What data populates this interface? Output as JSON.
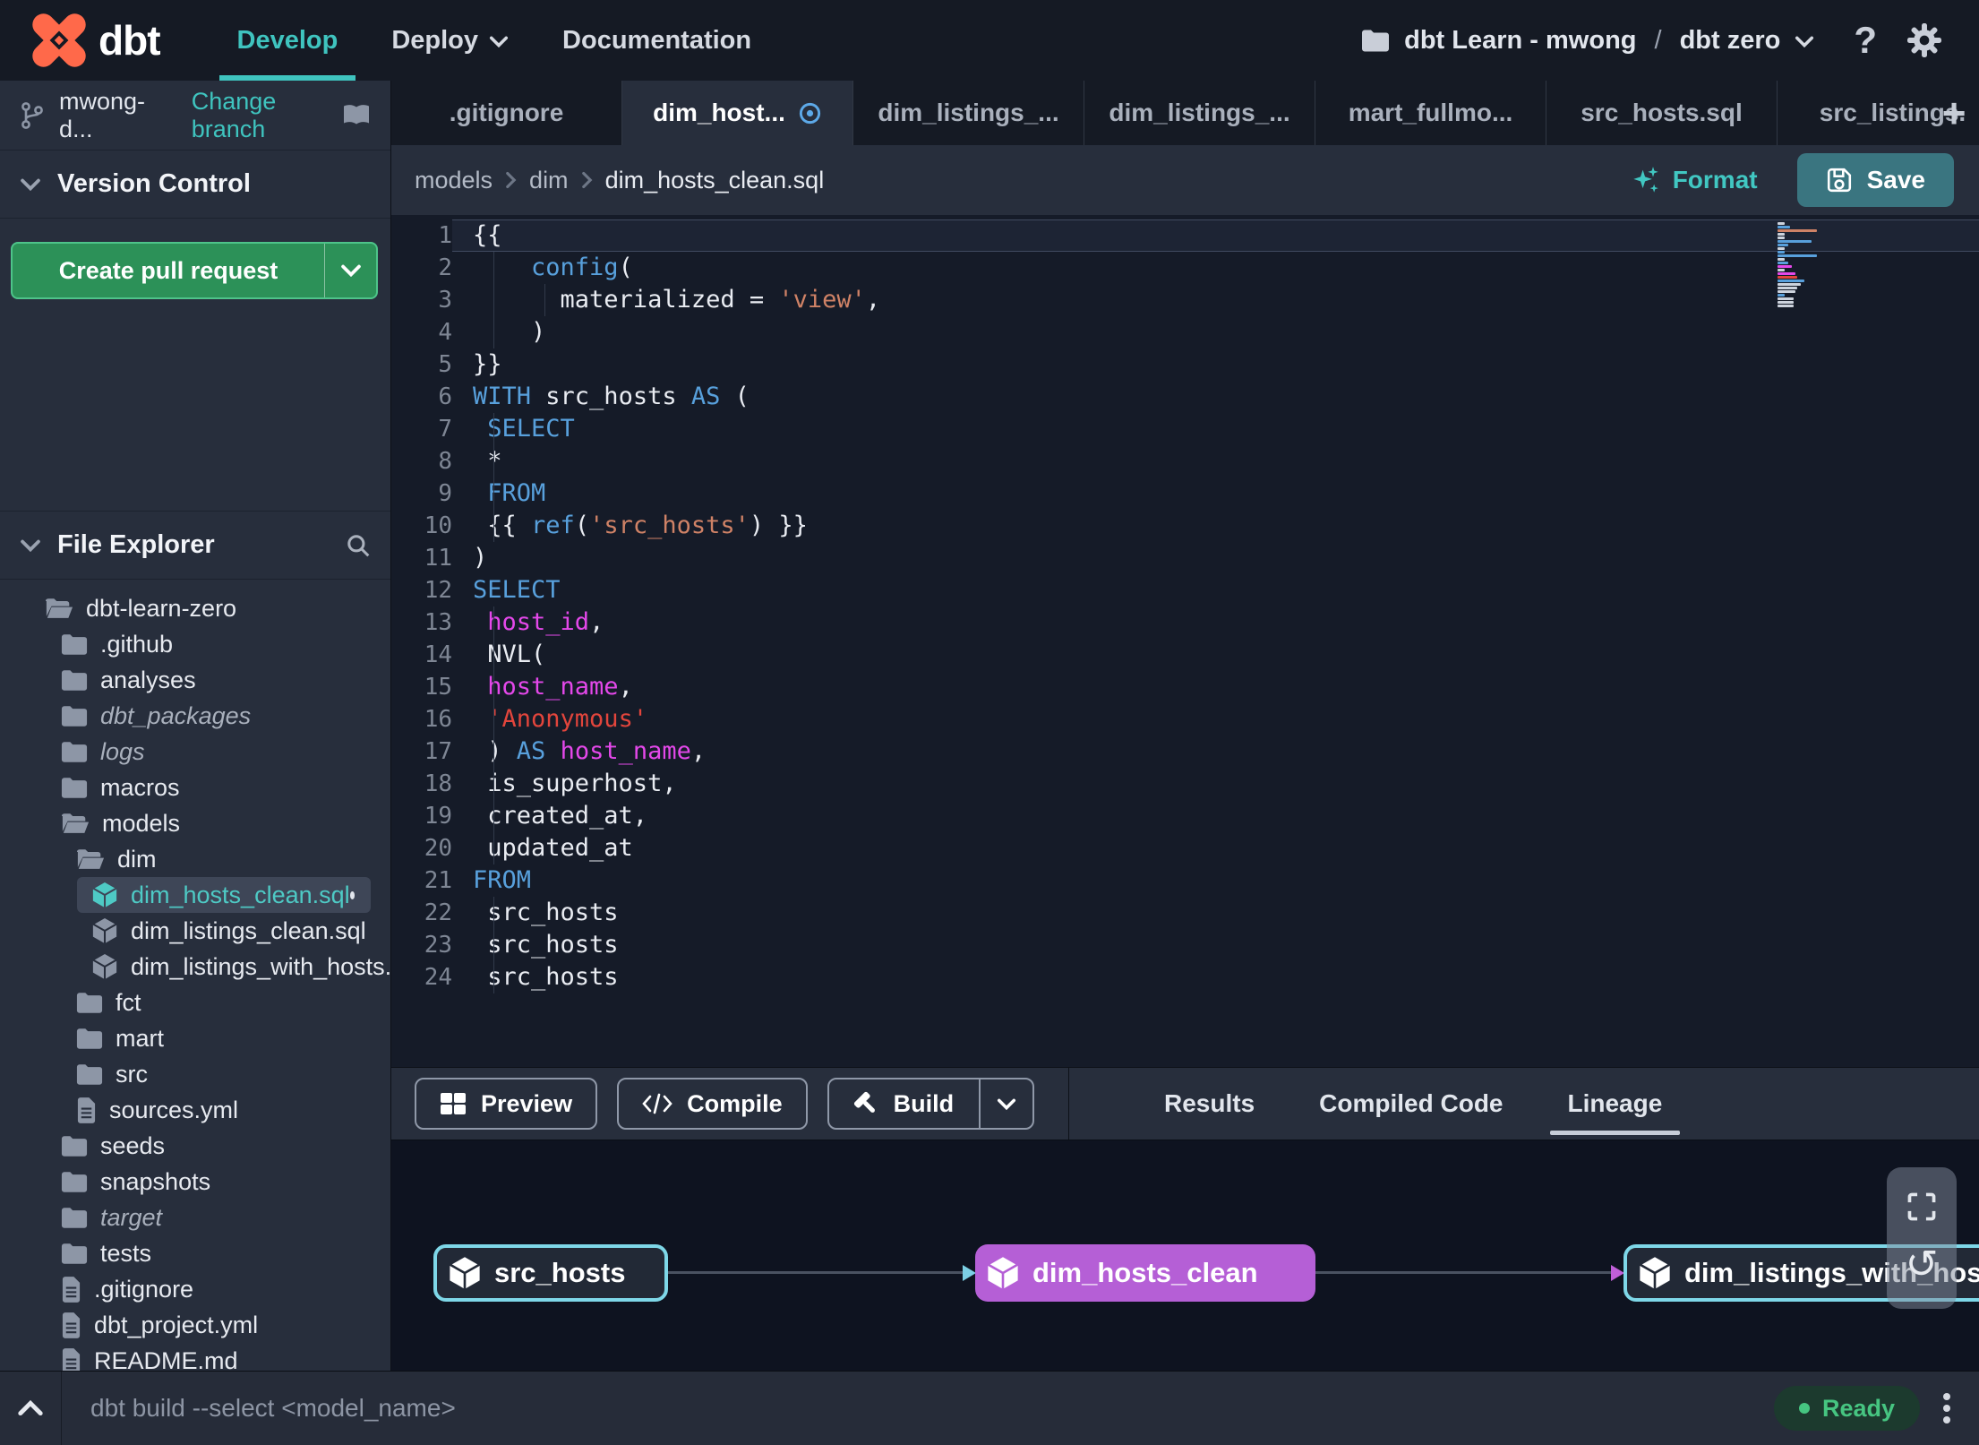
{
  "topbar": {
    "brand": "dbt",
    "nav": [
      {
        "label": "Develop",
        "active": true
      },
      {
        "label": "Deploy",
        "chevron": true
      },
      {
        "label": "Documentation"
      }
    ],
    "project_picker": {
      "account": "dbt Learn - mwong",
      "divider": "/",
      "project": "dbt zero"
    },
    "help_label": "?"
  },
  "sidebar": {
    "branch": {
      "name": "mwong-d...",
      "action": "Change branch"
    },
    "version_control": {
      "title": "Version Control",
      "button": "Create pull request"
    },
    "file_explorer": {
      "title": "File Explorer"
    },
    "tree": [
      {
        "label": "dbt-learn-zero",
        "type": "folder-open",
        "level": 0
      },
      {
        "label": ".github",
        "type": "folder",
        "level": 1
      },
      {
        "label": "analyses",
        "type": "folder",
        "level": 1
      },
      {
        "label": "dbt_packages",
        "type": "folder",
        "level": 1,
        "italic": true
      },
      {
        "label": "logs",
        "type": "folder",
        "level": 1,
        "italic": true
      },
      {
        "label": "macros",
        "type": "folder",
        "level": 1
      },
      {
        "label": "models",
        "type": "folder-open",
        "level": 1
      },
      {
        "label": "dim",
        "type": "folder-open",
        "level": 2
      },
      {
        "label": "dim_hosts_clean.sql",
        "type": "model",
        "level": 3,
        "selected": true,
        "dot": true
      },
      {
        "label": "dim_listings_clean.sql",
        "type": "model",
        "level": 3
      },
      {
        "label": "dim_listings_with_hosts...",
        "type": "model",
        "level": 3
      },
      {
        "label": "fct",
        "type": "folder",
        "level": 2
      },
      {
        "label": "mart",
        "type": "folder",
        "level": 2
      },
      {
        "label": "src",
        "type": "folder",
        "level": 2
      },
      {
        "label": "sources.yml",
        "type": "file",
        "level": 2
      },
      {
        "label": "seeds",
        "type": "folder",
        "level": 1
      },
      {
        "label": "snapshots",
        "type": "folder",
        "level": 1
      },
      {
        "label": "target",
        "type": "folder",
        "level": 1,
        "italic": true
      },
      {
        "label": "tests",
        "type": "folder",
        "level": 1
      },
      {
        "label": ".gitignore",
        "type": "file",
        "level": 1
      },
      {
        "label": "dbt_project.yml",
        "type": "file",
        "level": 1
      },
      {
        "label": "README.md",
        "type": "file",
        "level": 1
      }
    ]
  },
  "tabs": {
    "items": [
      {
        "label": ".gitignore"
      },
      {
        "label": "dim_host...",
        "active": true,
        "unsaved": true
      },
      {
        "label": "dim_listings_..."
      },
      {
        "label": "dim_listings_..."
      },
      {
        "label": "mart_fullmo..."
      },
      {
        "label": "src_hosts.sql"
      },
      {
        "label": "src_listings."
      }
    ],
    "add_label": "+"
  },
  "breadcrumb": {
    "segments": [
      "models",
      "dim",
      "dim_hosts_clean.sql"
    ],
    "format_label": "Format",
    "save_label": "Save"
  },
  "editor": {
    "lines": [
      {
        "n": 1,
        "current": true,
        "tokens": [
          [
            "p",
            "{{"
          ]
        ]
      },
      {
        "n": 2,
        "tokens": [
          [
            "p",
            "    "
          ],
          [
            "f",
            "config"
          ],
          [
            "p",
            "("
          ]
        ]
      },
      {
        "n": 3,
        "tokens": [
          [
            "p",
            "      materialized = "
          ],
          [
            "s",
            "'view'"
          ],
          [
            "p",
            ","
          ]
        ]
      },
      {
        "n": 4,
        "tokens": [
          [
            "p",
            "    )"
          ]
        ]
      },
      {
        "n": 5,
        "tokens": [
          [
            "p",
            "}}"
          ]
        ]
      },
      {
        "n": 6,
        "tokens": [
          [
            "k",
            "WITH"
          ],
          [
            "p",
            " src_hosts "
          ],
          [
            "k",
            "AS"
          ],
          [
            "p",
            " ("
          ]
        ]
      },
      {
        "n": 7,
        "tokens": [
          [
            "p",
            " "
          ],
          [
            "k",
            "SELECT"
          ]
        ]
      },
      {
        "n": 8,
        "tokens": [
          [
            "p",
            " *"
          ]
        ]
      },
      {
        "n": 9,
        "tokens": [
          [
            "p",
            " "
          ],
          [
            "k",
            "FROM"
          ]
        ]
      },
      {
        "n": 10,
        "tokens": [
          [
            "p",
            " {{ "
          ],
          [
            "f",
            "ref"
          ],
          [
            "p",
            "("
          ],
          [
            "s",
            "'src_hosts'"
          ],
          [
            "p",
            ") }}"
          ]
        ]
      },
      {
        "n": 11,
        "tokens": [
          [
            "p",
            ")"
          ]
        ]
      },
      {
        "n": 12,
        "tokens": [
          [
            "k",
            "SELECT"
          ]
        ]
      },
      {
        "n": 13,
        "tokens": [
          [
            "p",
            " "
          ],
          [
            "m",
            "host_id"
          ],
          [
            "p",
            ","
          ]
        ]
      },
      {
        "n": 14,
        "tokens": [
          [
            "p",
            " NVL("
          ]
        ]
      },
      {
        "n": 15,
        "tokens": [
          [
            "p",
            " "
          ],
          [
            "m",
            "host_name"
          ],
          [
            "p",
            ","
          ]
        ]
      },
      {
        "n": 16,
        "tokens": [
          [
            "p",
            " "
          ],
          [
            "r",
            "'Anonymous'"
          ]
        ]
      },
      {
        "n": 17,
        "tokens": [
          [
            "p",
            " ) "
          ],
          [
            "k",
            "AS"
          ],
          [
            "p",
            " "
          ],
          [
            "m",
            "host_name"
          ],
          [
            "p",
            ","
          ]
        ]
      },
      {
        "n": 18,
        "tokens": [
          [
            "p",
            " is_superhost,"
          ]
        ]
      },
      {
        "n": 19,
        "tokens": [
          [
            "p",
            " created_at,"
          ]
        ]
      },
      {
        "n": 20,
        "tokens": [
          [
            "p",
            " updated_at"
          ]
        ]
      },
      {
        "n": 21,
        "tokens": [
          [
            "k",
            "FROM"
          ]
        ]
      },
      {
        "n": 22,
        "tokens": [
          [
            "p",
            " src_hosts"
          ]
        ]
      },
      {
        "n": 23,
        "tokens": [
          [
            "p",
            " src_hosts"
          ]
        ]
      },
      {
        "n": 24,
        "tokens": [
          [
            "p",
            " src_hosts"
          ]
        ]
      }
    ]
  },
  "toolbar": {
    "buttons": [
      {
        "label": "Preview",
        "icon": "grid"
      },
      {
        "label": "Compile",
        "icon": "code"
      },
      {
        "label": "Build",
        "icon": "hammer",
        "has_dropdown": true
      }
    ],
    "tabs": [
      {
        "label": "Results"
      },
      {
        "label": "Compiled Code"
      },
      {
        "label": "Lineage",
        "active": true
      }
    ]
  },
  "lineage": {
    "nodes": [
      {
        "label": "src_hosts",
        "style": "outlined"
      },
      {
        "label": "dim_hosts_clean",
        "style": "filled"
      },
      {
        "label": "dim_listings_with_hosts",
        "style": "outlined"
      }
    ]
  },
  "statusbar": {
    "command": "dbt build --select <model_name>",
    "status": "Ready"
  },
  "colors": {
    "accent_teal": "#3fc4bf",
    "brand_orange": "#ff694a",
    "node_purple": "#b55fd6",
    "node_teal_border": "#7ed7e8",
    "ready_green": "#46c581",
    "unsaved_blue": "#5da9e8",
    "save_button": "#3a7580",
    "pr_button_green": "#2c9158",
    "code_keyword": "#58a0dc",
    "code_string": "#cf8266",
    "code_string_alt": "#e2453c",
    "code_identifier": "#e448ea"
  }
}
